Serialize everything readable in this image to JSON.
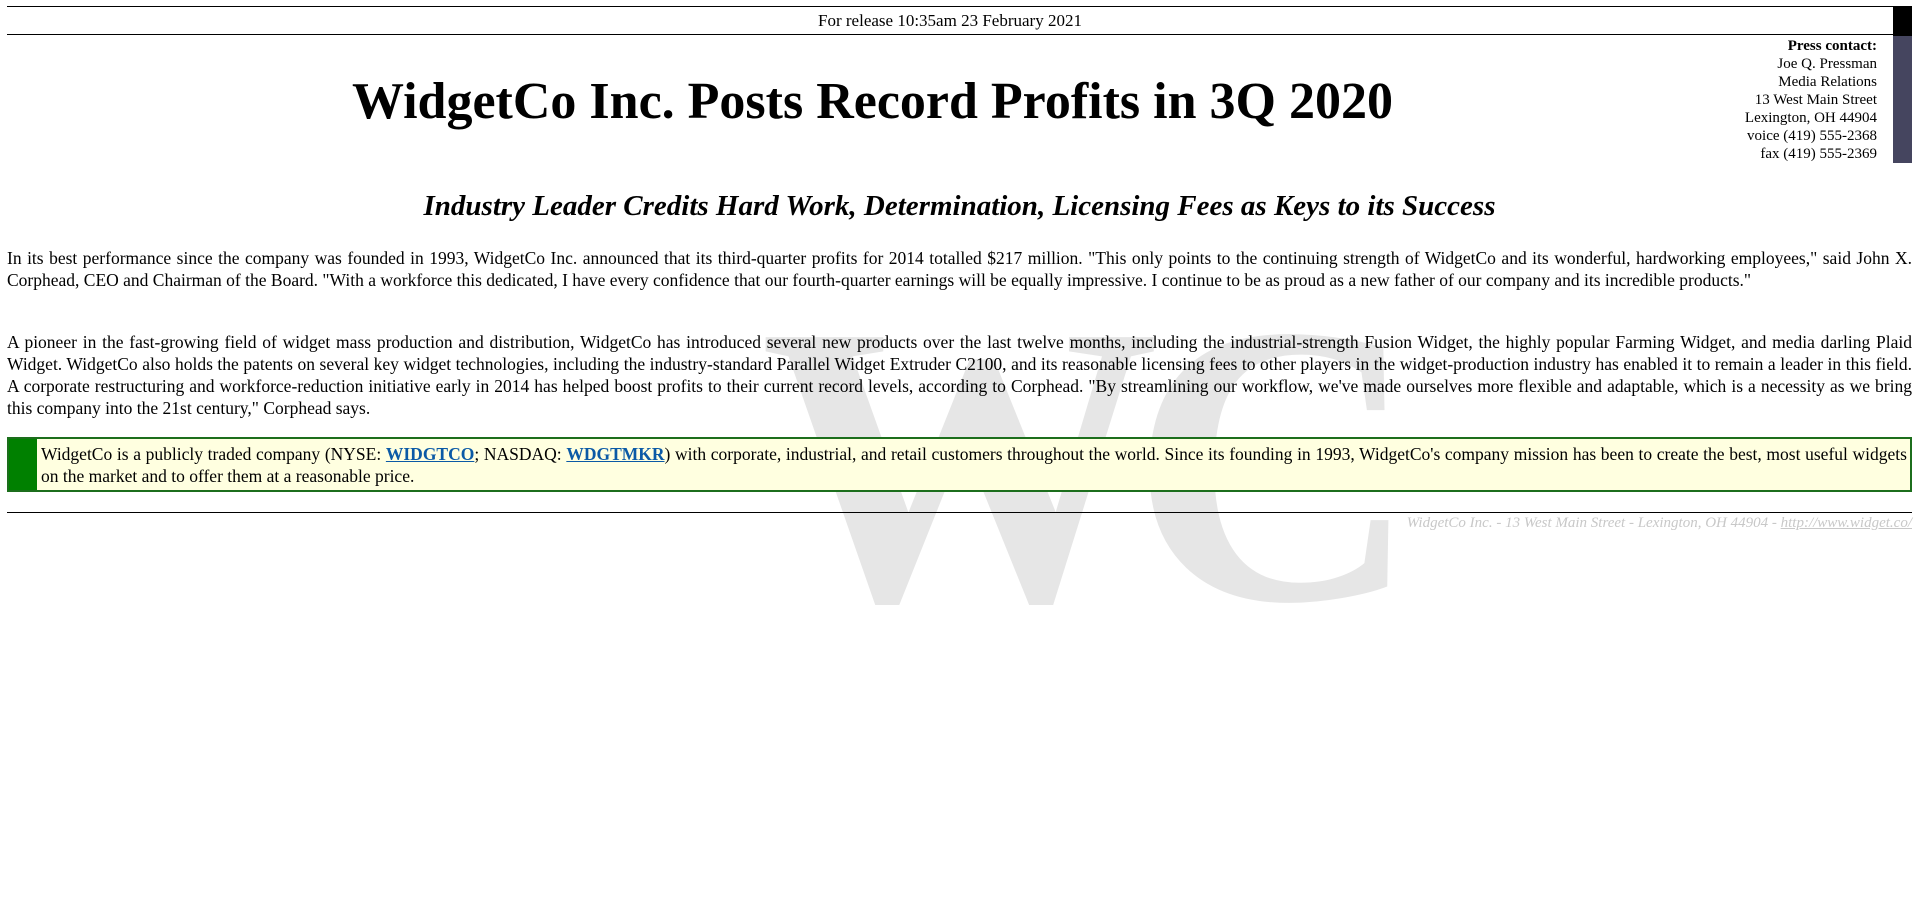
{
  "release": {
    "text": "For release 10:35am 23 February 2021"
  },
  "press_contact": {
    "heading": "Press contact:",
    "name": "Joe Q. Pressman",
    "department": "Media Relations",
    "street": "13 West Main Street",
    "city": "Lexington, OH 44904",
    "voice": "voice (419) 555-2368",
    "fax": "fax (419) 555-2369"
  },
  "headline": "WidgetCo Inc. Posts Record Profits in 3Q 2020",
  "subhead": "Industry Leader Credits Hard Work, Determination, Licensing Fees as Keys to its Success",
  "paragraphs": [
    "In its best performance since the company was founded in 1993, WidgetCo Inc. announced that its third-quarter profits for 2014 totalled $217 million. \"This only points to the continuing strength of WidgetCo and its wonderful, hardworking employees,\" said John X. Corphead, CEO and Chairman of the Board. \"With a workforce this dedicated, I have every confidence that our fourth-quarter earnings will be equally impressive. I continue to be as proud as a new father of our company and its incredible products.\"",
    "A pioneer in the fast-growing field of widget mass production and distribution, WidgetCo has introduced several new products over the last twelve months, including the industrial-strength Fusion Widget, the highly popular Farming Widget, and media darling Plaid Widget. WidgetCo also holds the patents on several key widget technologies, including the industry-standard Parallel Widget Extruder C2100, and its reasonable licensing fees to other players in the widget-production industry has enabled it to remain a leader in this field. A corporate restructuring and workforce-reduction initiative early in 2014 has helped boost profits to their current record levels, according to Corphead. \"By streamlining our workflow, we've made ourselves more flexible and adaptable, which is a necessity as we bring this company into the 21st century,\" Corphead says."
  ],
  "callout": {
    "before_nyse": "WidgetCo is a publicly traded company (NYSE: ",
    "nyse_ticker": "WIDGTCO",
    "between": "; NASDAQ: ",
    "nasdaq_ticker": "WDGTMKR",
    "after": ") with corporate, industrial, and retail customers throughout the world. Since its founding in 1993, WidgetCo's company mission has been to create the best, most useful widgets on the market and to offer them at a reasonable price."
  },
  "footer": {
    "address": "WidgetCo Inc. - 13 West Main Street - Lexington, OH 44904 - ",
    "url": "http://www.widget.co/"
  },
  "watermark": {
    "text": "WC"
  },
  "colors": {
    "accent_bar": "#45455f",
    "callout_bar": "#008000",
    "callout_border": "#1c6e1c",
    "callout_bg": "#ffffe0",
    "link": "#0b5aa6",
    "footer_text": "#c8c8c8",
    "watermark": "#e6e6e6"
  }
}
